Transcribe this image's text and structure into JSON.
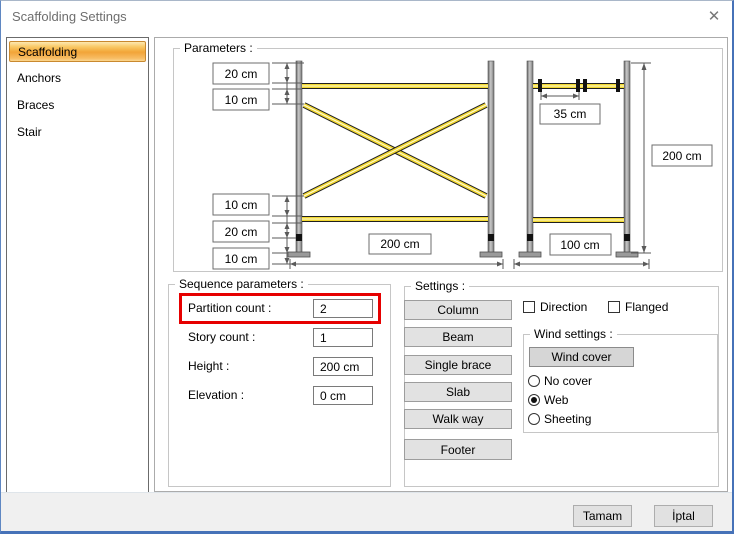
{
  "window": {
    "title": "Scaffolding Settings",
    "close_icon": "✕"
  },
  "sidebar": {
    "items": [
      {
        "label": "Scaffolding",
        "selected": true
      },
      {
        "label": "Anchors",
        "selected": false
      },
      {
        "label": "Braces",
        "selected": false
      },
      {
        "label": "Stair",
        "selected": false
      }
    ]
  },
  "parameters": {
    "group_label": "Parameters :",
    "diagram": {
      "front": {
        "top_labels": [
          "20 cm",
          "10 cm"
        ],
        "bottom_labels": [
          "10 cm",
          "20 cm",
          "10 cm"
        ],
        "width_label": "200 cm"
      },
      "side": {
        "spacing_label": "35 cm",
        "height_label": "200 cm",
        "width_label": "100 cm"
      }
    }
  },
  "sequence": {
    "group_label": "Sequence parameters :",
    "fields": [
      {
        "label": "Partition count :",
        "value": "2",
        "highlighted": true
      },
      {
        "label": "Story count :",
        "value": "1",
        "highlighted": false
      },
      {
        "label": "Height :",
        "value": "200 cm",
        "highlighted": false
      },
      {
        "label": "Elevation :",
        "value": "0 cm",
        "highlighted": false
      }
    ]
  },
  "settings": {
    "group_label": "Settings :",
    "buttons": [
      "Column",
      "Beam",
      "Single brace",
      "Slab",
      "Walk way",
      "Footer"
    ],
    "checkboxes": [
      {
        "label": "Direction",
        "checked": false
      },
      {
        "label": "Flanged",
        "checked": false
      }
    ],
    "wind": {
      "group_label": "Wind settings :",
      "button": "Wind cover",
      "radios": [
        {
          "label": "No cover",
          "selected": false
        },
        {
          "label": "Web",
          "selected": true
        },
        {
          "label": "Sheeting",
          "selected": false
        }
      ]
    }
  },
  "footer": {
    "ok_label": "Tamam",
    "cancel_label": "İptal"
  },
  "colors": {
    "selected_orange": "#f3a93c",
    "highlight_red": "#e60000",
    "rail_yellow": "#f2d832",
    "window_border_blue": "#4672b8"
  }
}
